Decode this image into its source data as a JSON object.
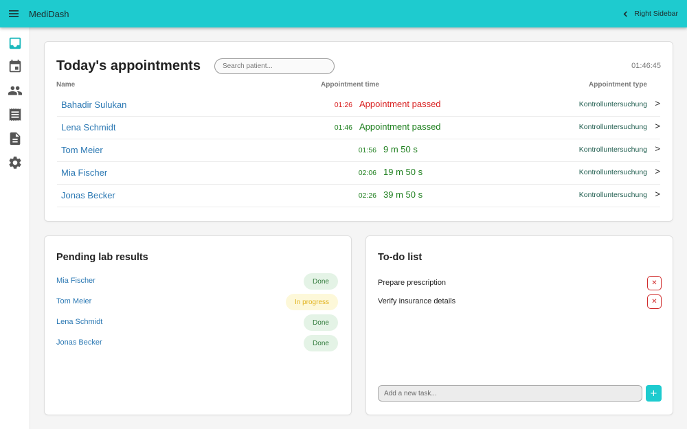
{
  "app": {
    "title": "MediDash",
    "right_sidebar_label": "Right Sidebar"
  },
  "sidebar": {
    "items": [
      "inbox-icon",
      "calendar-icon",
      "people-icon",
      "receipt-icon",
      "document-icon",
      "settings-icon"
    ]
  },
  "appointments": {
    "title": "Today's appointments",
    "search_placeholder": "Search patient...",
    "clock": "01:46:45",
    "headers": {
      "name": "Name",
      "time": "Appointment time",
      "type": "Appointment type"
    },
    "rows": [
      {
        "name": "Bahadir Sulukan",
        "time": "01:26",
        "status": "Appointment passed",
        "type": "Kontrolluntersuchung",
        "arrow": ">"
      },
      {
        "name": "Lena Schmidt",
        "time": "01:46",
        "status": "Appointment passed",
        "type": "Kontrolluntersuchung",
        "arrow": ">"
      },
      {
        "name": "Tom Meier",
        "time": "01:56",
        "status": "9 m 50 s",
        "type": "Kontrolluntersuchung",
        "arrow": ">"
      },
      {
        "name": "Mia Fischer",
        "time": "02:06",
        "status": "19 m 50 s",
        "type": "Kontrolluntersuchung",
        "arrow": ">"
      },
      {
        "name": "Jonas Becker",
        "time": "02:26",
        "status": "39 m 50 s",
        "type": "Kontrolluntersuchung",
        "arrow": ">"
      }
    ]
  },
  "lab": {
    "title": "Pending lab results",
    "rows": [
      {
        "name": "Mia Fischer",
        "status": "Done"
      },
      {
        "name": "Tom Meier",
        "status": "In progress"
      },
      {
        "name": "Lena Schmidt",
        "status": "Done"
      },
      {
        "name": "Jonas Becker",
        "status": "Done"
      }
    ]
  },
  "todo": {
    "title": "To-do list",
    "items": [
      {
        "text": "Prepare prescription",
        "delete_symbol": "✕"
      },
      {
        "text": "Verify insurance details",
        "delete_symbol": "✕"
      }
    ],
    "input_placeholder": "Add a new task...",
    "add_label": "+"
  },
  "colors": {
    "accent": "#1ecbcf",
    "link": "#2b78b3",
    "passed": "#d81f1f",
    "ok": "#1e7f1e"
  }
}
